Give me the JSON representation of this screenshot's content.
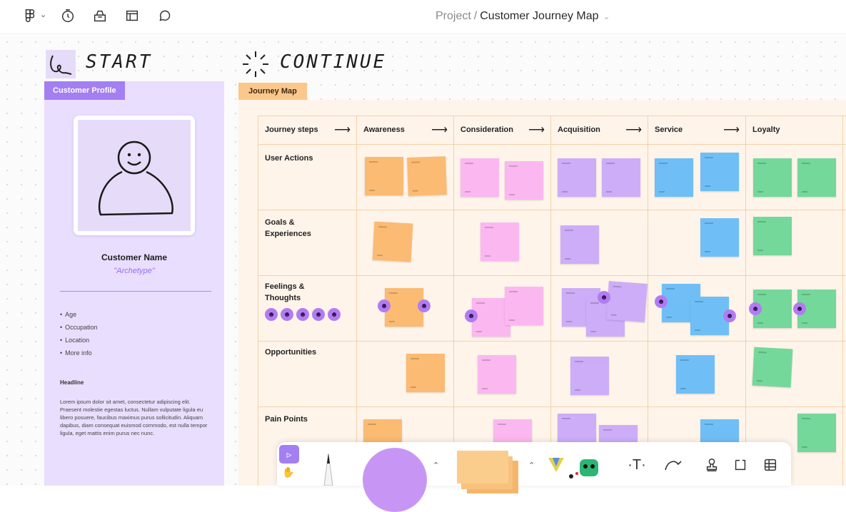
{
  "header": {
    "breadcrumb_project": "Project",
    "breadcrumb_sep": "/",
    "title": "Customer Journey Map",
    "title_chevron": "⌄",
    "icons": [
      "figjam-logo-icon",
      "timer-icon",
      "library-icon",
      "layout-icon",
      "comment-icon"
    ],
    "menu_chevron": "⌄"
  },
  "sections": {
    "start": "START",
    "continue": "CONTINUE"
  },
  "profile": {
    "tag": "Customer Profile",
    "name": "Customer Name",
    "archetype": "\"Archetype\"",
    "bullets": [
      "Age",
      "Occupation",
      "Location",
      "More info"
    ],
    "headline": "Headline",
    "body": "Lorem ipsum dolor sit amet, consectetur adipiscing elit. Praesent molestie egestas luctus. Nullam vulputate ligula eu libero posuere, faucibus maximus purus sollicitudin. Aliquam dapibus, diam consequat euismod commodo, est nulla tempor ligula, eget mattis enim purus nec nunc."
  },
  "journey": {
    "tag": "Journey Map",
    "arrow": "⟶",
    "columns": [
      "Journey steps",
      "Awareness",
      "Consideration",
      "Acquisition",
      "Service",
      "Loyalty"
    ],
    "rows": [
      "User Actions",
      "Goals & Experiences",
      "Feelings & Thoughts",
      "Opportunities",
      "Pain Points"
    ],
    "emoji_glyph": "☻"
  },
  "colors": {
    "profile_accent": "#a37ff2",
    "journey_accent": "#fbc78b",
    "awareness": "#fbbb73",
    "consideration": "#fbb8f0",
    "acquisition": "#cdadf8",
    "service": "#6fbff6",
    "loyalty": "#74d89a"
  },
  "toolbar": {
    "select_glyph": "▹",
    "hand_glyph": "✋",
    "caret": "⌃",
    "text_tool": "·T·",
    "tools": [
      "move-tool",
      "hand-tool",
      "marker-tool",
      "shape-tool",
      "sticky-tool",
      "stickers-tool",
      "text-tool",
      "connector-tool",
      "stamp-tool",
      "section-tool",
      "table-tool"
    ]
  }
}
